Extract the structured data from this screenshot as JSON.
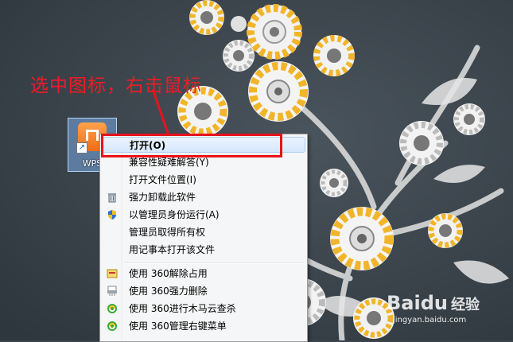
{
  "annotation": {
    "text": "选中图标，右击鼠标",
    "color": "#ee1c25"
  },
  "desktop_icon": {
    "label": "WPS",
    "icon": "wps-app-icon"
  },
  "context_menu": {
    "items": [
      {
        "label": "打开(O)",
        "icon": "",
        "bold": true
      },
      {
        "label": "兼容性疑难解答(Y)",
        "icon": ""
      },
      {
        "label": "打开文件位置(I)",
        "icon": ""
      },
      {
        "label": "强力卸载此软件",
        "icon": "trash-icon"
      },
      {
        "label": "以管理员身份运行(A)",
        "icon": "uac-shield-icon"
      },
      {
        "label": "管理员取得所有权",
        "icon": ""
      },
      {
        "label": "用记事本打开该文件",
        "icon": ""
      },
      {
        "label": "使用 360解除占用",
        "icon": "360-unlock-icon"
      },
      {
        "label": "使用 360强力删除",
        "icon": "360-shredder-icon"
      },
      {
        "label": "使用 360进行木马云查杀",
        "icon": "360-guard-icon"
      },
      {
        "label": "使用 360管理右键菜单",
        "icon": "360-guard-icon"
      }
    ]
  },
  "highlight_color": "#e8121b",
  "watermark": {
    "brand": "Bai",
    "brand_suffix": "du",
    "brand_cn": "经验",
    "url": "jingyan.baidu.com"
  }
}
